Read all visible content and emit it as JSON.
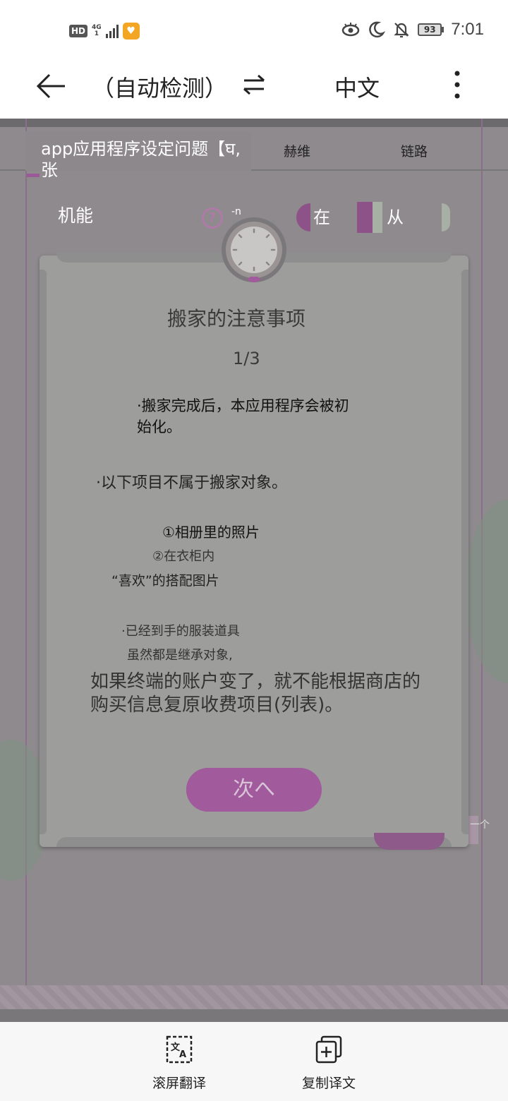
{
  "status_bar": {
    "hd": "HD",
    "network": "4G",
    "network_sub": "1",
    "battery": "93",
    "time": "7:01"
  },
  "toolbar": {
    "source_language": "（自动检测）",
    "target_language": "中文"
  },
  "app": {
    "tab_active": "app应用程序设定问题【घ,张",
    "tab_2": "赫维",
    "tab_3": "链路",
    "feature_label": "机能",
    "help_mark": "?",
    "mini_text": "-n",
    "segment_left": "在",
    "segment_right": "从",
    "side_text": "一个"
  },
  "dialog": {
    "title": "搬家的注意事项",
    "page": "1/3",
    "line_a": "·搬家完成后，本应用程序会被初始化。",
    "line_b": "·以下项目不属于搬家对象。",
    "line_c": "①相册里的照片",
    "line_d": "②在衣柜内",
    "line_e": "“喜欢”的搭配图片",
    "line_f": "·已经到手的服装道具",
    "line_g": "虽然都是继承对象,",
    "line_h": "如果终端的账户变了，就不能根据商店的购买信息复原收费项目(列表)。",
    "next_button": "次へ"
  },
  "bottom_bar": {
    "scroll_translate": "滚屏翻译",
    "copy_translation": "复制译文"
  }
}
